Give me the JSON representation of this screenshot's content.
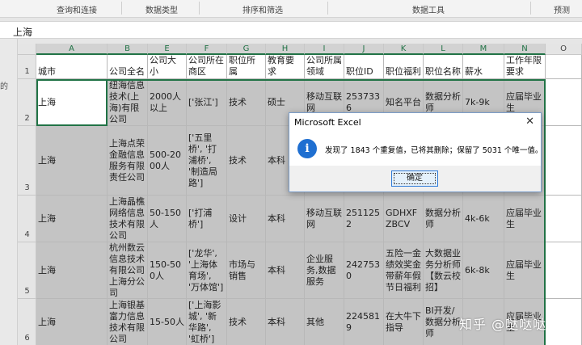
{
  "ribbon": {
    "groups": [
      "查询和连接",
      "数据类型",
      "排序和筛选",
      "数据工具",
      "预测"
    ]
  },
  "formula_bar": {
    "value": "上海"
  },
  "left_pane_text": "的",
  "columns": [
    "A",
    "B",
    "E",
    "F",
    "G",
    "H",
    "I",
    "J",
    "K",
    "L",
    "M",
    "N",
    "O"
  ],
  "rows": [
    "1",
    "2",
    "3",
    "4",
    "5",
    "6"
  ],
  "headers": [
    "城市",
    "公司全名",
    "公司大小",
    "公司所在商区",
    "职位所属",
    "教育要求",
    "公司所属领域",
    "职位ID",
    "职位福利",
    "职位名称",
    "薪水",
    "工作年限要求"
  ],
  "data_rows": [
    [
      "上海",
      "纽海信息技术(上海)有限公司",
      "2000人以上",
      "['张江']",
      "技术",
      "硕士",
      "移动互联网",
      "2537336",
      "知名平台",
      "数据分析师",
      "7k-9k",
      "应届毕业生"
    ],
    [
      "上海",
      "上海点荣金融信息服务有限责任公司",
      "500-2000人",
      "['五里桥', '打浦桥', '制造局路']",
      "技术",
      "本科",
      "",
      "",
      "",
      "",
      "",
      ""
    ],
    [
      "上海",
      "上海晶樵网络信息技术有限公司",
      "50-150人",
      "['打浦桥']",
      "设计",
      "本科",
      "移动互联网",
      "2511252",
      "GDHXFZBCV",
      "数据分析师",
      "4k-6k",
      "应届毕业生"
    ],
    [
      "上海",
      "杭州数云信息技术有限公司上海分公司",
      "150-500人",
      "['龙华', '上海体育场', '万体馆']",
      "市场与销售",
      "本科",
      "企业服务,数据服务",
      "2427530",
      "五险一金绩效奖金带薪年假节日福利",
      "大数据业务分析师【数云校招】",
      "6k-8k",
      "应届毕业生"
    ],
    [
      "上海",
      "上海银基富力信息技术有限公司",
      "15-50人",
      "['上海影城', '新华路', '虹桥']",
      "技术",
      "本科",
      "其他",
      "2245819",
      "在大牛下指导",
      "BI开发/数据分析师",
      "",
      "应届毕业生"
    ]
  ],
  "dialog": {
    "title": "Microsoft Excel",
    "message": "发现了 1843 个重复值，已将其删除；保留了 5031 个唯一值。",
    "ok_label": "确定",
    "close_glyph": "✕",
    "icon_glyph": "i",
    "icon_color": "#1f6fd1"
  },
  "watermark": "知乎 @哒哒哒",
  "colors": {
    "accent": "#217346",
    "selection_shade": "#c4c4c4"
  }
}
